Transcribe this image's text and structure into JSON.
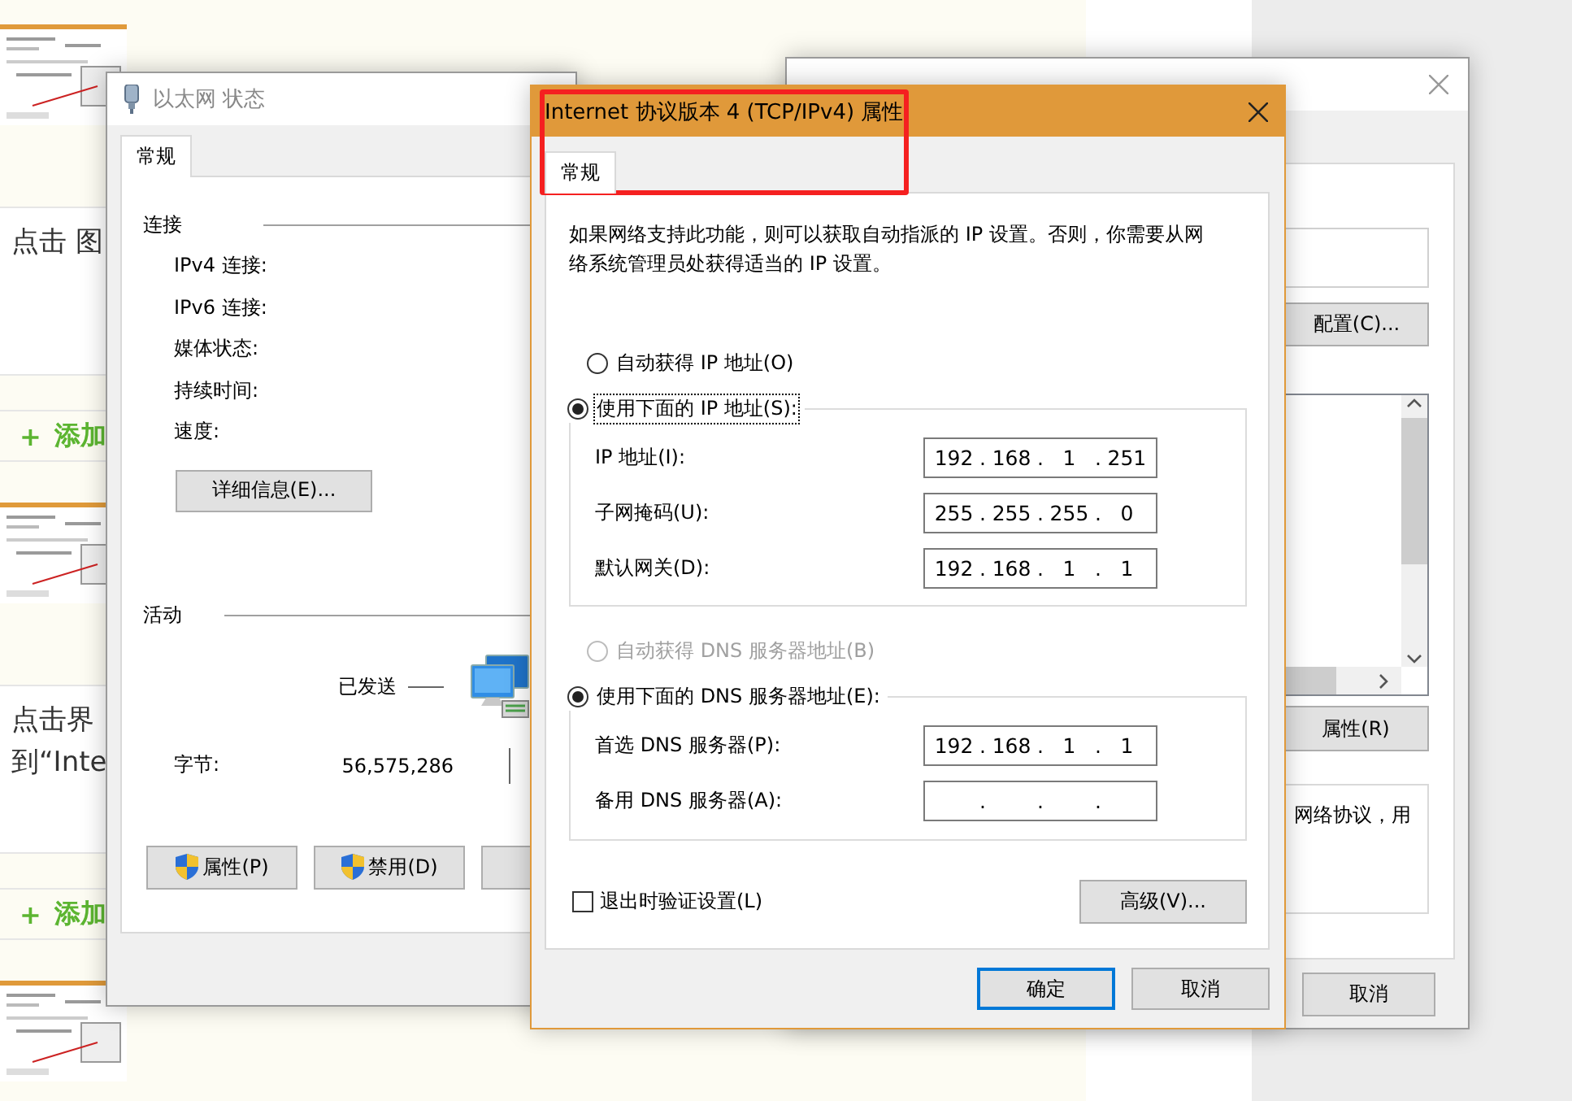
{
  "article": {
    "items": [
      {
        "kind": "picture"
      },
      {
        "kind": "text",
        "lines": [
          "点击 图"
        ]
      },
      {
        "kind": "add",
        "icon": "+",
        "label": "添加"
      },
      {
        "kind": "picture"
      },
      {
        "kind": "text",
        "lines": [
          "点击界",
          "到“Inte"
        ]
      },
      {
        "kind": "add",
        "icon": "+",
        "label": "添加"
      },
      {
        "kind": "picture"
      }
    ]
  },
  "status_window": {
    "title": "以太网 状态",
    "tabs": [
      {
        "label": "常规",
        "selected": true
      }
    ],
    "connection": {
      "heading": "连接",
      "fields": [
        "IPv4 连接:",
        "IPv6 连接:",
        "媒体状态:",
        "持续时间:",
        "速度:"
      ],
      "details_button": "详细信息(E)..."
    },
    "activity": {
      "heading": "活动",
      "sent_label": "已发送",
      "bytes_label": "字节:",
      "bytes_sent": "56,575,286"
    },
    "buttons": [
      {
        "kind": "shield",
        "label": "属性(P)"
      },
      {
        "kind": "shield",
        "label": "禁用(D)"
      },
      {
        "kind": "plain"
      }
    ]
  },
  "properties_window": {
    "configure_button": "配置(C)...",
    "properties_button": "属性(R)",
    "description": "网络协议，用",
    "cancel_button": "取消"
  },
  "ipv4_dialog": {
    "title": "Internet 协议版本 4 (TCP/IPv4) 属性",
    "tabs": [
      {
        "label": "常规",
        "selected": true
      }
    ],
    "description": "如果网络支持此功能，则可以获取自动指派的 IP 设置。否则，你需要从网络系统管理员处获得适当的 IP 设置。",
    "ip_mode": [
      {
        "label": "自动获得 IP 地址(O)",
        "selected": false,
        "disabled": false,
        "focused": false
      },
      {
        "label": "使用下面的 IP 地址(S):",
        "selected": true,
        "disabled": false,
        "focused": true
      }
    ],
    "ip_fields": [
      {
        "label": "IP 地址(I):",
        "separator": ".",
        "octets": [
          "192",
          "168",
          "1",
          "251"
        ]
      },
      {
        "label": "子网掩码(U):",
        "separator": ".",
        "octets": [
          "255",
          "255",
          "255",
          "0"
        ]
      },
      {
        "label": "默认网关(D):",
        "separator": ".",
        "octets": [
          "192",
          "168",
          "1",
          "1"
        ]
      }
    ],
    "dns_mode": [
      {
        "label": "自动获得 DNS 服务器地址(B)",
        "selected": false,
        "disabled": true,
        "focused": false
      },
      {
        "label": "使用下面的 DNS 服务器地址(E):",
        "selected": true,
        "disabled": false,
        "focused": false
      }
    ],
    "dns_fields": [
      {
        "label": "首选 DNS 服务器(P):",
        "separator": ".",
        "octets": [
          "192",
          "168",
          "1",
          "1"
        ]
      },
      {
        "label": "备用 DNS 服务器(A):",
        "separator": "."
      }
    ],
    "validate": {
      "label": "退出时验证设置(L)",
      "checked": false
    },
    "advanced_button": "高级(V)...",
    "buttons": [
      {
        "label": "确定",
        "default": true
      },
      {
        "label": "取消",
        "default": false
      }
    ]
  }
}
